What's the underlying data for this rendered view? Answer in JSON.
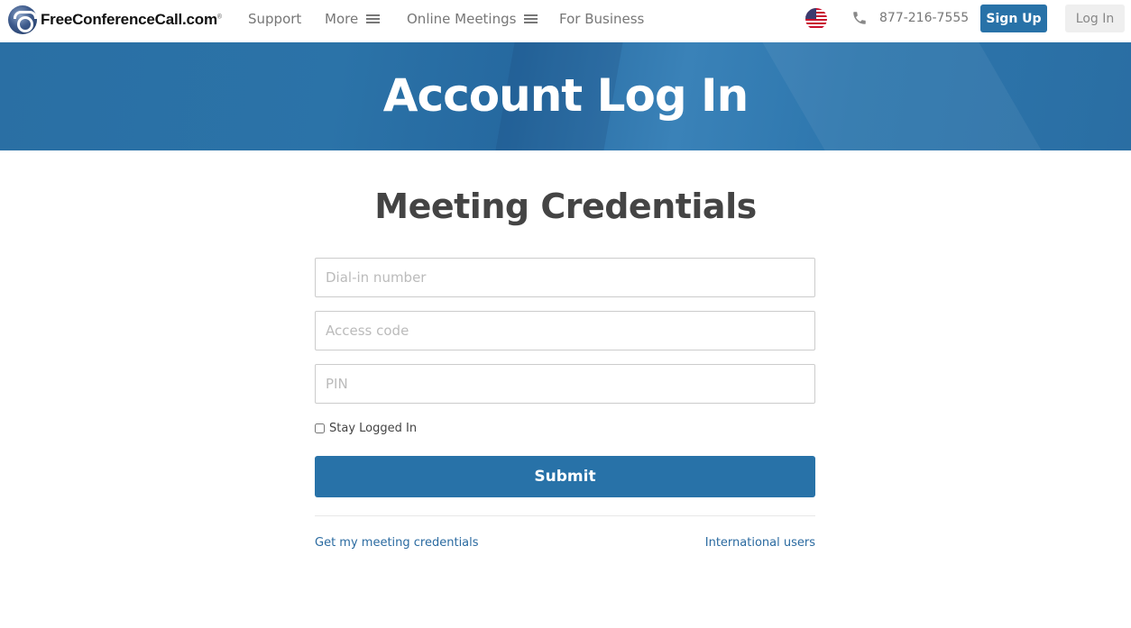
{
  "header": {
    "logo_text": "FreeConferenceCall.com",
    "logo_mark": "®",
    "nav": [
      {
        "label": "Support",
        "has_menu": false
      },
      {
        "label": "More",
        "has_menu": true
      },
      {
        "label": "Online Meetings",
        "has_menu": true
      },
      {
        "label": "For Business",
        "has_menu": false
      }
    ],
    "country_flag": "us-flag-icon",
    "phone_icon": "phone-icon",
    "phone_number": "877-216-7555",
    "signup_label": "Sign Up",
    "login_label": "Log In"
  },
  "hero": {
    "title": "Account Log In"
  },
  "form": {
    "title": "Meeting Credentials",
    "fields": [
      {
        "placeholder": "Dial-in number",
        "value": ""
      },
      {
        "placeholder": "Access code",
        "value": ""
      },
      {
        "placeholder": "PIN",
        "value": ""
      }
    ],
    "stay_logged_in_label": "Stay Logged In",
    "stay_logged_in_checked": false,
    "submit_label": "Submit",
    "links": {
      "left": "Get my meeting credentials",
      "right": "International users"
    }
  },
  "colors": {
    "brand_blue": "#2872a8",
    "link_blue": "#2a6aa0"
  }
}
